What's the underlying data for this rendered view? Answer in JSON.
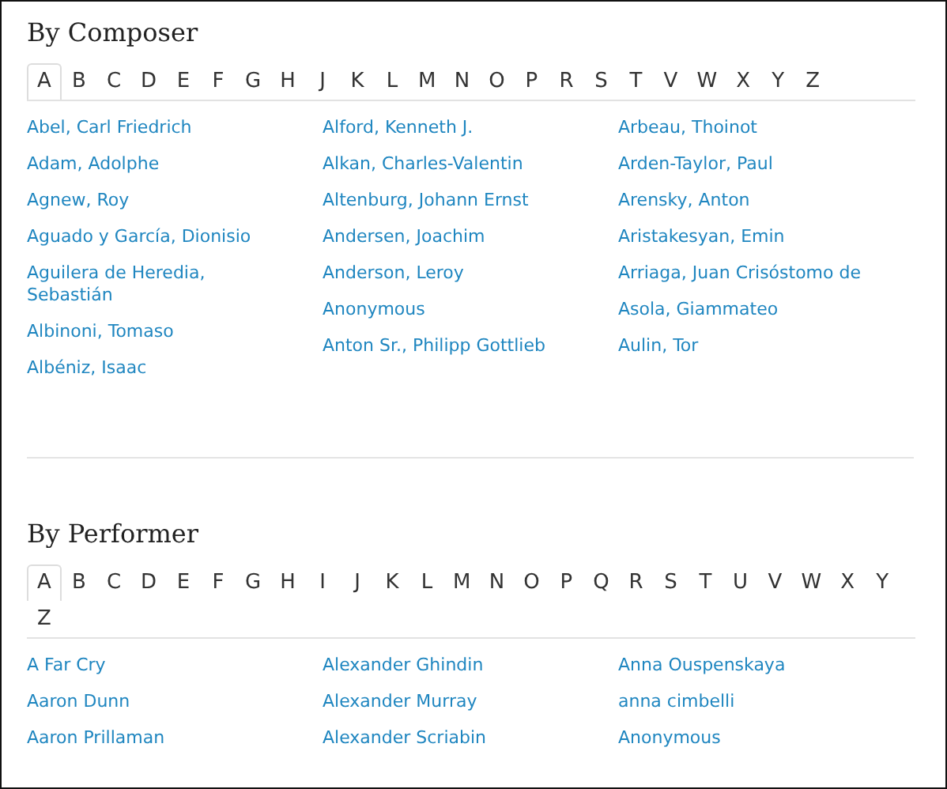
{
  "sections": [
    {
      "title": "By Composer",
      "letters": [
        {
          "label": "A",
          "selected": true
        },
        {
          "label": "B",
          "selected": false
        },
        {
          "label": "C",
          "selected": false
        },
        {
          "label": "D",
          "selected": false
        },
        {
          "label": "E",
          "selected": false
        },
        {
          "label": "F",
          "selected": false
        },
        {
          "label": "G",
          "selected": false
        },
        {
          "label": "H",
          "selected": false
        },
        {
          "label": "J",
          "selected": false
        },
        {
          "label": "K",
          "selected": false
        },
        {
          "label": "L",
          "selected": false
        },
        {
          "label": "M",
          "selected": false
        },
        {
          "label": "N",
          "selected": false
        },
        {
          "label": "O",
          "selected": false
        },
        {
          "label": "P",
          "selected": false
        },
        {
          "label": "R",
          "selected": false
        },
        {
          "label": "S",
          "selected": false
        },
        {
          "label": "T",
          "selected": false
        },
        {
          "label": "V",
          "selected": false
        },
        {
          "label": "W",
          "selected": false
        },
        {
          "label": "X",
          "selected": false
        },
        {
          "label": "Y",
          "selected": false
        },
        {
          "label": "Z",
          "selected": false
        }
      ],
      "columns": [
        [
          "Abel, Carl Friedrich",
          "Adam, Adolphe",
          "Agnew, Roy",
          "Aguado y García, Dionisio",
          "Aguilera de Heredia, Sebastián",
          "Albinoni, Tomaso",
          "Albéniz, Isaac"
        ],
        [
          "Alford, Kenneth J.",
          "Alkan, Charles-Valentin",
          "Altenburg, Johann Ernst",
          "Andersen, Joachim",
          "Anderson, Leroy",
          "Anonymous",
          "Anton Sr., Philipp Gottlieb"
        ],
        [
          "Arbeau, Thoinot",
          "Arden-Taylor, Paul",
          "Arensky, Anton",
          "Aristakesyan, Emin",
          "Arriaga, Juan Crisóstomo de",
          "Asola, Giammateo",
          "Aulin, Tor"
        ]
      ]
    },
    {
      "title": "By Performer",
      "letters": [
        {
          "label": "A",
          "selected": true
        },
        {
          "label": "B",
          "selected": false
        },
        {
          "label": "C",
          "selected": false
        },
        {
          "label": "D",
          "selected": false
        },
        {
          "label": "E",
          "selected": false
        },
        {
          "label": "F",
          "selected": false
        },
        {
          "label": "G",
          "selected": false
        },
        {
          "label": "H",
          "selected": false
        },
        {
          "label": "I",
          "selected": false
        },
        {
          "label": "J",
          "selected": false
        },
        {
          "label": "K",
          "selected": false
        },
        {
          "label": "L",
          "selected": false
        },
        {
          "label": "M",
          "selected": false
        },
        {
          "label": "N",
          "selected": false
        },
        {
          "label": "O",
          "selected": false
        },
        {
          "label": "P",
          "selected": false
        },
        {
          "label": "Q",
          "selected": false
        },
        {
          "label": "R",
          "selected": false
        },
        {
          "label": "S",
          "selected": false
        },
        {
          "label": "T",
          "selected": false
        },
        {
          "label": "U",
          "selected": false
        },
        {
          "label": "V",
          "selected": false
        },
        {
          "label": "W",
          "selected": false
        },
        {
          "label": "X",
          "selected": false
        },
        {
          "label": "Y",
          "selected": false
        },
        {
          "label": "Z",
          "selected": false
        }
      ],
      "columns": [
        [
          "A Far Cry",
          "Aaron Dunn",
          "Aaron Prillaman"
        ],
        [
          "Alexander Ghindin",
          "Alexander Murray",
          "Alexander Scriabin"
        ],
        [
          "Anna Ouspenskaya",
          "anna cimbelli",
          "Anonymous"
        ]
      ]
    }
  ]
}
